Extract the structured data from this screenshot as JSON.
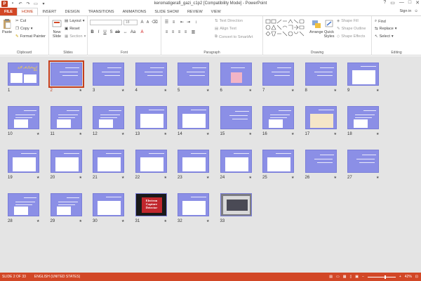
{
  "window": {
    "title": "keromatigerafi_gazi_c1p2 [Compatibility Mode] - PowerPoint",
    "controls": [
      "?",
      "▭",
      "—",
      "□",
      "✕"
    ]
  },
  "tabs": [
    "FILE",
    "HOME",
    "INSERT",
    "DESIGN",
    "TRANSITIONS",
    "ANIMATIONS",
    "SLIDE SHOW",
    "REVIEW",
    "VIEW"
  ],
  "active_tab": "HOME",
  "signin": "Sign in",
  "ribbon": {
    "clipboard": {
      "paste": "Paste",
      "cut": "Cut",
      "copy": "Copy",
      "format_painter": "Format Painter",
      "label": "Clipboard"
    },
    "slides": {
      "new_slide": "New Slide",
      "layout": "Layout",
      "reset": "Reset",
      "section": "Section",
      "label": "Slides"
    },
    "font": {
      "font_size": "18",
      "label": "Font"
    },
    "paragraph": {
      "text_direction": "Text Direction",
      "align_text": "Align Text",
      "convert": "Convert to SmartArt",
      "label": "Paragraph"
    },
    "drawing": {
      "arrange": "Arrange",
      "quick_styles": "Quick Styles",
      "shape_fill": "Shape Fill",
      "shape_outline": "Shape Outline",
      "shape_effects": "Shape Effects",
      "label": "Drawing"
    },
    "editing": {
      "find": "Find",
      "replace": "Replace",
      "select": "Select",
      "label": "Editing"
    }
  },
  "slides": {
    "count": 33,
    "selected": 2,
    "numbers": [
      "1",
      "2",
      "3",
      "4",
      "5",
      "6",
      "7",
      "8",
      "9",
      "10",
      "11",
      "12",
      "13",
      "14",
      "15",
      "16",
      "17",
      "18",
      "19",
      "20",
      "21",
      "22",
      "23",
      "24",
      "25",
      "26",
      "27",
      "28",
      "29",
      "30",
      "31",
      "32",
      "33"
    ],
    "slide1_title": "کروماتوگرافی گازی GC",
    "slide31_text": "Electron Capture Detector"
  },
  "status": {
    "slide_info": "SLIDE 2 OF 33",
    "language": "ENGLISH (UNITED STATES)",
    "zoom": "42%"
  },
  "colors": {
    "accent": "#d24726",
    "slide_bg": "#8b8fe6",
    "sorter_bg": "#e4e4e4"
  }
}
